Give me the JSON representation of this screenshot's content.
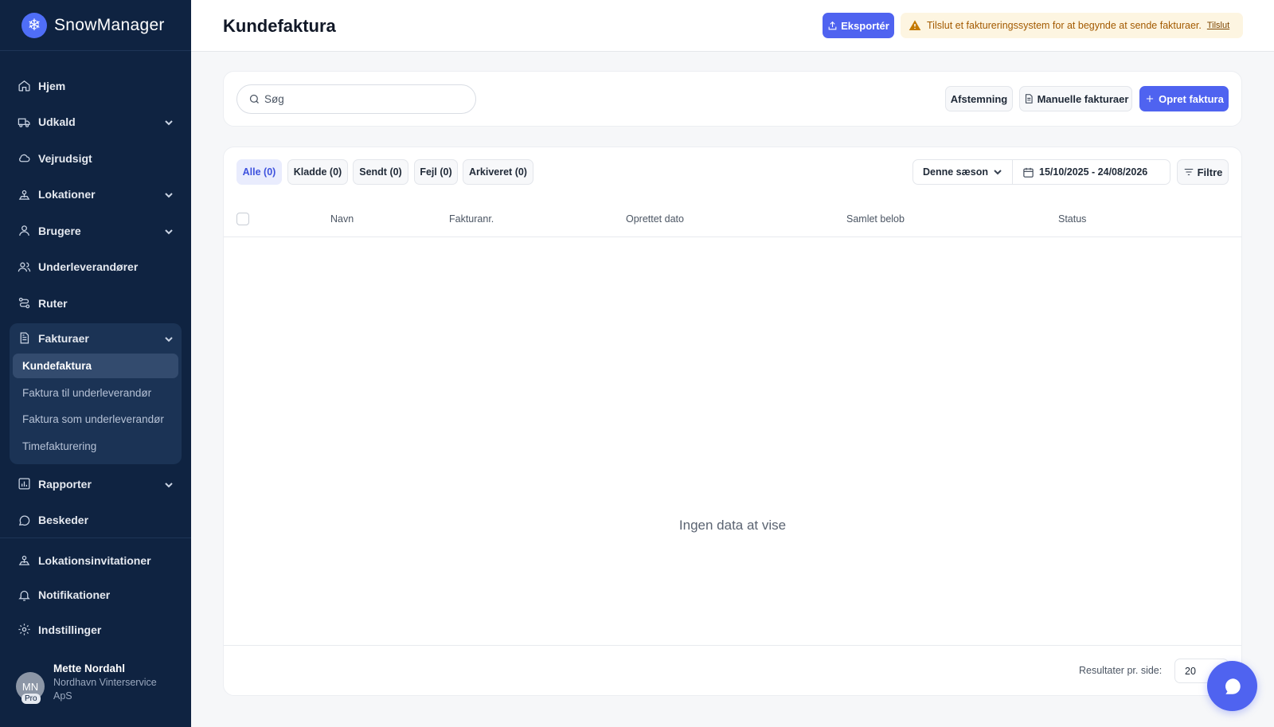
{
  "app": {
    "name": "SnowManager"
  },
  "sidebar": {
    "items": [
      {
        "label": "Hjem"
      },
      {
        "label": "Udkald"
      },
      {
        "label": "Vejrudsigt"
      },
      {
        "label": "Lokationer"
      },
      {
        "label": "Brugere"
      },
      {
        "label": "Underleverandører"
      },
      {
        "label": "Ruter"
      }
    ],
    "invoices": {
      "label": "Fakturaer",
      "sub": [
        {
          "label": "Kundefaktura"
        },
        {
          "label": "Faktura til underleverandør"
        },
        {
          "label": "Faktura som underleverandør"
        },
        {
          "label": "Timefakturering"
        }
      ]
    },
    "after": [
      {
        "label": "Rapporter"
      },
      {
        "label": "Beskeder"
      }
    ],
    "bottom": [
      {
        "label": "Lokationsinvitationer"
      },
      {
        "label": "Notifikationer"
      },
      {
        "label": "Indstillinger"
      }
    ],
    "user": {
      "initials": "MN",
      "badge": "Pro",
      "name": "Mette Nordahl",
      "company": "Nordhavn Vinterservice ApS"
    }
  },
  "header": {
    "title": "Kundefaktura",
    "export_label": "Eksportér",
    "warning_text": "Tilslut et faktureringssystem for at begynde at sende fakturaer.",
    "warning_link": "Tilslut"
  },
  "toolbar": {
    "search_placeholder": "Søg",
    "reconcile_label": "Afstemning",
    "manual_label": "Manuelle fakturaer",
    "create_label": "Opret faktura"
  },
  "tabs": [
    {
      "label": "Alle (0)"
    },
    {
      "label": "Kladde (0)"
    },
    {
      "label": "Sendt (0)"
    },
    {
      "label": "Fejl (0)"
    },
    {
      "label": "Arkiveret (0)"
    }
  ],
  "filters": {
    "season": "Denne sæson",
    "date_range": "15/10/2025 - 24/08/2026",
    "filter_label": "Filtre"
  },
  "table": {
    "columns": [
      "Navn",
      "Fakturanr.",
      "Oprettet dato",
      "Samlet belob",
      "Status"
    ],
    "empty_text": "Ingen data at vise"
  },
  "pagination": {
    "label": "Resultater pr. side:",
    "value": "20"
  },
  "colors": {
    "sidebar": "#0f2341",
    "accent": "#4f63f0",
    "warning_bg": "#fdf5e1"
  }
}
